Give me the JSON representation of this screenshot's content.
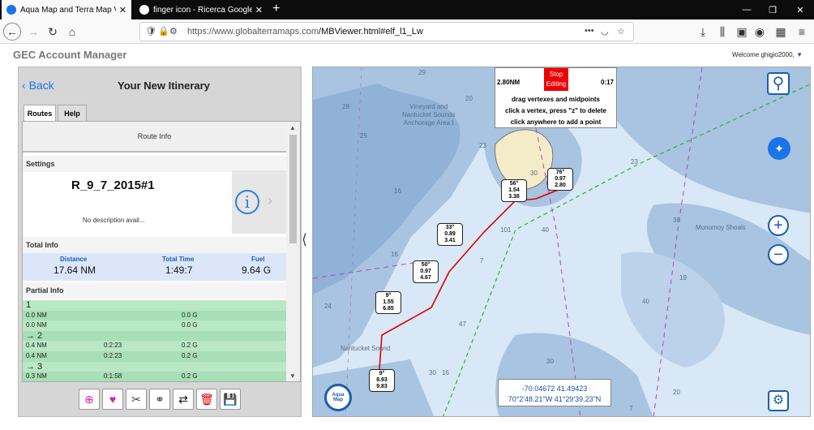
{
  "browser": {
    "tabs": [
      {
        "title": "Aqua Map and Terra Map View",
        "active": true
      },
      {
        "title": "finger icon - Ricerca Google",
        "active": false
      }
    ],
    "url_domain": "https://www.globalterramaps.com",
    "url_path": "/MBViewer.html#elf_l1_Lw",
    "url_menu": "•••"
  },
  "page": {
    "app_title": "GEC Account Manager",
    "welcome": "Welcome ghigio2000,"
  },
  "panel": {
    "back_label": "Back",
    "title": "Your New Itinerary",
    "tabs": [
      "Routes",
      "Help"
    ],
    "route_info_label": "Route Info",
    "settings_label": "Settings",
    "route_name": "R_9_7_2015#1",
    "route_desc": "No description avail...",
    "total_info_label": "Total Info",
    "totals": {
      "distance_label": "Distance",
      "distance": "17.64 NM",
      "time_label": "Total Time",
      "time": "1:49:7",
      "fuel_label": "Fuel",
      "fuel": "9.64 G"
    },
    "partial_info_label": "Partial Info",
    "partial_rows": [
      {
        "type": "head",
        "text": "1"
      },
      {
        "type": "row",
        "dist": "0.0 NM",
        "time": "",
        "fuel": "0.0 G"
      },
      {
        "type": "row",
        "dist": "0.0 NM",
        "time": "",
        "fuel": "0.0 G"
      },
      {
        "type": "head",
        "text": "→ 2"
      },
      {
        "type": "row",
        "dist": "0.4 NM",
        "time": "0:2:23",
        "fuel": "0.2 G"
      },
      {
        "type": "row",
        "dist": "0.4 NM",
        "time": "0:2:23",
        "fuel": "0.2 G"
      },
      {
        "type": "head",
        "text": "→ 3"
      },
      {
        "type": "row",
        "dist": "0.3 NM",
        "time": "0:1:58",
        "fuel": "0.2 G"
      }
    ]
  },
  "map": {
    "edit": {
      "distance": "2.80NM",
      "stop_label": "Stop Editing",
      "time": "0:17",
      "hint1": "drag vertexes and midpoints",
      "hint2": "click a vertex, press \"z\" to delete",
      "hint3": "click anywhere to add a point"
    },
    "coords_decimal": "-70.04672 41.49423",
    "coords_dms": "70°2'48.21\"W 41°29'39.23\"N",
    "place_labels": [
      "Vineyard and",
      "Nantucket Sounds",
      "Anchorage Area I",
      "Nantucket Sound",
      "Monomoy Shoals"
    ],
    "route_labels": [
      {
        "bearing": "76°",
        "dist": "0.97",
        "cum": "2.80"
      },
      {
        "bearing": "56°",
        "dist": "1.54",
        "cum": "3.38"
      },
      {
        "bearing": "33°",
        "dist": "0.89",
        "cum": "3.41"
      },
      {
        "bearing": "50°",
        "dist": "0.97",
        "cum": "4.67"
      },
      {
        "bearing": "9°",
        "dist": "1.55",
        "cum": "6.85"
      },
      {
        "bearing": "9°",
        "dist": "8.93",
        "cum": "9.83"
      }
    ],
    "depths": [
      "29",
      "28",
      "20",
      "25",
      "16",
      "23",
      "30",
      "23",
      "101",
      "40",
      "36",
      "16",
      "7",
      "19",
      "24",
      "40",
      "47",
      "30",
      "30",
      "16",
      "7",
      "20"
    ],
    "logo_text": "Aqua Map",
    "colors": {
      "route": "#e00000",
      "land": "#f4ecc8",
      "shallow": "#a8c4e0",
      "deep": "#d8e8f6"
    }
  }
}
